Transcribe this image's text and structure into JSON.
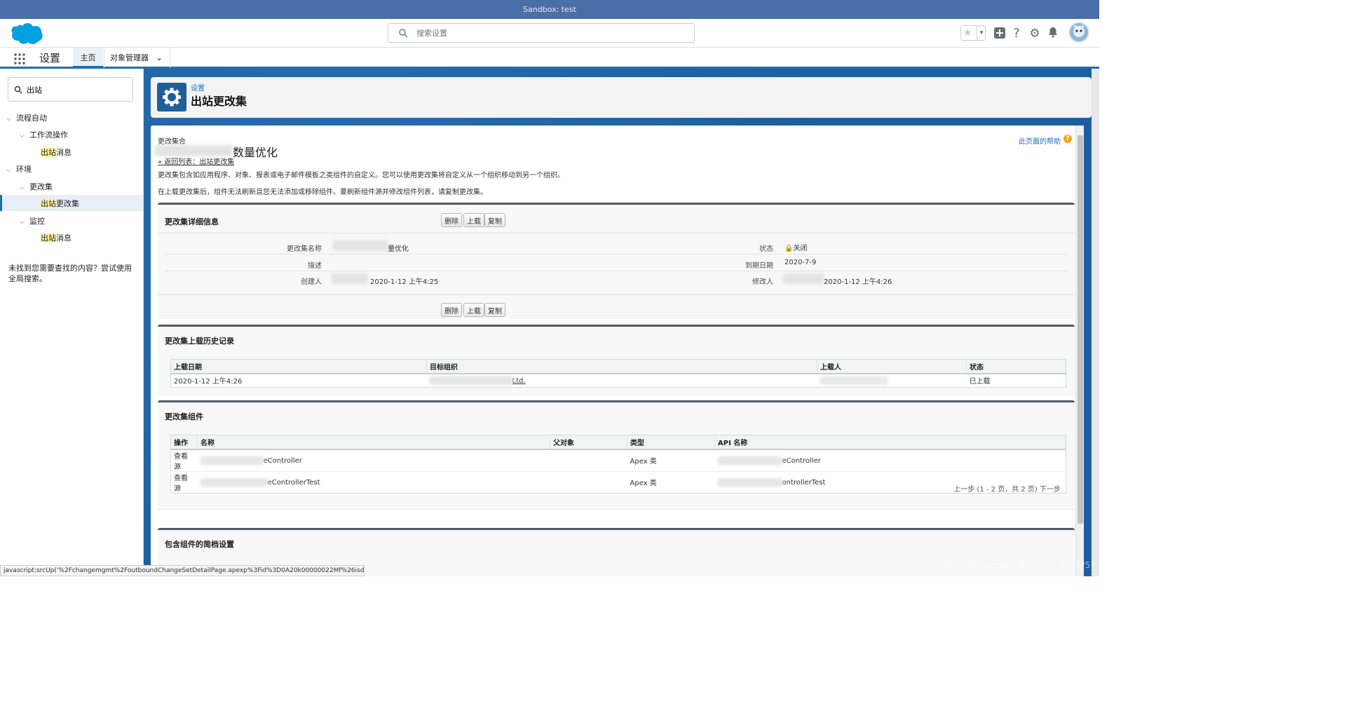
{
  "sandbox_bar": {
    "text": "Sandbox: test"
  },
  "header": {
    "search_placeholder": "搜索设置"
  },
  "navbar": {
    "app_name": "设置",
    "tabs": [
      {
        "label": "主页"
      },
      {
        "label": "对象管理器"
      }
    ]
  },
  "sidebar": {
    "quick_find_value": "出站",
    "tree": [
      {
        "label": "流程自动"
      },
      {
        "label": "工作流操作"
      },
      {
        "label_hl": "出站",
        "label_rest": "消息"
      },
      {
        "label": "环境"
      },
      {
        "label": "更改集"
      },
      {
        "label_hl": "出站",
        "label_rest": "更改集"
      },
      {
        "label": "监控"
      },
      {
        "label_hl": "出站",
        "label_rest": "消息"
      }
    ],
    "not_found": "未找到您需要查找的内容？尝试使用全局搜索。"
  },
  "page_header": {
    "breadcrumb": "设置",
    "title": "出站更改集"
  },
  "content": {
    "section_label": "更改集合",
    "record_title_suffix": "数量优化",
    "back_link": "« 返回列表：出站更改集",
    "desc1": "更改集包含如应用程序、对象、报表或电子邮件模板之类组件的自定义。您可以使用更改集将自定义从一个组织移动到另一个组织。",
    "desc2": "在上载更改集后，组件无法刷新且您无法添加或移除组件。要刷新组件源并修改组件列表，请复制更改集。",
    "help_link": "此页面的帮助",
    "detail": {
      "title": "更改集详细信息",
      "buttons": {
        "delete": "删除",
        "upload": "上载",
        "clone": "复制"
      },
      "name_label": "更改集名称",
      "name_value_suffix": "量优化",
      "status_label": "状态",
      "status_value": "关闭",
      "desc_label": "描述",
      "expire_label": "到期日期",
      "expire_value": "2020-7-9",
      "created_label": "创建人",
      "created_value": "2020-1-12 上午4:25",
      "modified_label": "修改人",
      "modified_value": "2020-1-12 上午4:26"
    },
    "history": {
      "title": "更改集上载历史记录",
      "columns": [
        "上载日期",
        "目标组织",
        "上载人",
        "状态"
      ],
      "rows": [
        {
          "date": "2020-1-12 上午4:26",
          "org_suffix": "Ltd.",
          "status": "已上载"
        }
      ]
    },
    "components": {
      "title": "更改集组件",
      "columns": [
        "操作",
        "名称",
        "父对象",
        "类型",
        "API 名称"
      ],
      "rows": [
        {
          "action": "查看源",
          "name_suffix": "eController",
          "type": "Apex 类",
          "api_suffix": "eController"
        },
        {
          "action": "查看源",
          "name_suffix": "eControllerTest",
          "type": "Apex 类",
          "api_suffix": "ontrollerTest"
        }
      ],
      "pagination": "上一步 (1 - 2 页，共 2 页) 下一步"
    },
    "profiles": {
      "title": "包含组件的简档设置"
    }
  },
  "status_bar": {
    "url": "javascript:srcUp('%2Fchangemgmt%2FoutboundChangeSetDetailPage.apexp%3Fid%3D0A20k00000022Mf%26isdtp%3..."
  },
  "watermark": "https://blog.csdn.net/weixin_4224?5?",
  "colors": {
    "brand_blue": "#1f6fb2",
    "sandbox_bar": "#4a6ea8",
    "salesforce_cloud": "#00a1e0"
  },
  "icons": [
    "salesforce-cloud-logo",
    "search-icon",
    "star-icon",
    "plus-icon",
    "help-icon",
    "gear-icon",
    "bell-icon",
    "avatar",
    "app-launcher-icon",
    "chevron-down-icon",
    "lock-icon"
  ]
}
